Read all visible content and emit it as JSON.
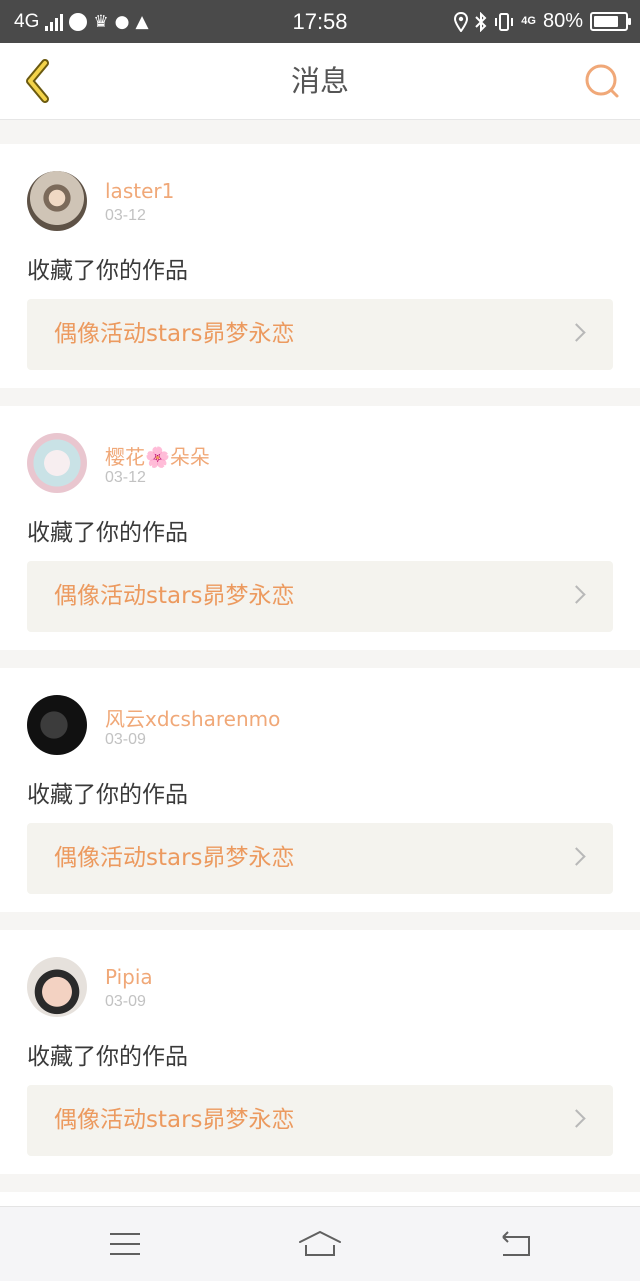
{
  "status_bar": {
    "network": "4G",
    "network_secondary": "4G",
    "time": "17:58",
    "battery_percent": "80%",
    "battery_level": 0.8
  },
  "nav": {
    "title": "消息",
    "back_icon": "chevron-left-icon",
    "search_icon": "search-icon"
  },
  "messages": [
    {
      "username": "laster1",
      "date": "03-12",
      "action": "收藏了你的作品",
      "work_title": "偶像活动stars昴梦永恋"
    },
    {
      "username": "樱花🌸朵朵",
      "date": "03-12",
      "action": "收藏了你的作品",
      "work_title": "偶像活动stars昴梦永恋"
    },
    {
      "username": "风云xdcsharenmo",
      "date": "03-09",
      "action": "收藏了你的作品",
      "work_title": "偶像活动stars昴梦永恋"
    },
    {
      "username": "Pipia",
      "date": "03-09",
      "action": "收藏了你的作品",
      "work_title": "偶像活动stars昴梦永恋"
    }
  ],
  "system_bar": {
    "icons": [
      "menu-icon",
      "home-icon",
      "back-icon"
    ]
  },
  "colors": {
    "accent": "#f0a878",
    "link_text": "#ec9a5f",
    "status_bar": "#4a4a4a"
  }
}
